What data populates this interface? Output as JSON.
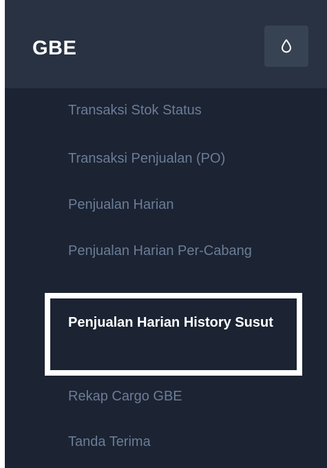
{
  "sidebar": {
    "brand": "GBE",
    "theme_toggle_icon": "droplet-icon",
    "items": [
      {
        "label": "Transaksi Stok Status",
        "active": false
      },
      {
        "label": "Transaksi Penjualan (PO)",
        "active": false
      },
      {
        "label": "Penjualan Harian",
        "active": false
      },
      {
        "label": "Penjualan Harian Per-Cabang",
        "active": false
      },
      {
        "label": "Penjualan Harian History Susut",
        "active": true
      },
      {
        "label": "Rekap Cargo GBE",
        "active": false
      },
      {
        "label": "Tanda Terima",
        "active": false
      }
    ]
  },
  "colors": {
    "sidebar_bg": "#1c2332",
    "header_bg": "#283242",
    "toggle_bg": "#374253",
    "item_text": "#6a7d98",
    "active_text": "#ffffff",
    "highlight_frame": "#ffffff"
  }
}
